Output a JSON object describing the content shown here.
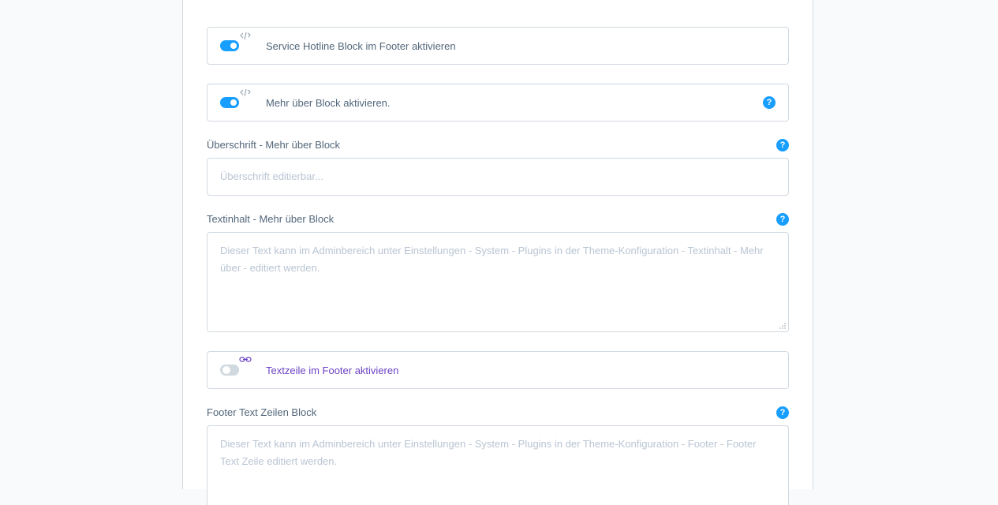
{
  "fields": {
    "hotline": {
      "label": "Service Hotline Block im Footer aktivieren",
      "enabled": true
    },
    "mehr_ueber": {
      "label": "Mehr über Block aktivieren.",
      "enabled": true
    },
    "ueberschrift": {
      "label": "Überschrift - Mehr über Block",
      "placeholder": "Überschrift editierbar..."
    },
    "textinhalt": {
      "label": "Textinhalt - Mehr über Block",
      "placeholder_line1": "Dieser Text kann im Adminbereich unter Einstellungen - System - Plugins in der Theme-Konfiguration - Textinhalt - Mehr",
      "placeholder_line2": "über - editiert werden."
    },
    "textzeile": {
      "label": "Textzeile im Footer aktivieren",
      "enabled": false
    },
    "footer_text": {
      "label": "Footer Text Zeilen Block",
      "placeholder_line1": "Dieser Text kann im Adminbereich unter Einstellungen - System - Plugins in der Theme-Konfiguration - Footer - Footer",
      "placeholder_line2": "Text Zeile editiert werden."
    }
  },
  "help_glyph": "?",
  "colors": {
    "accent": "#189eff",
    "linked": "#6c43c4",
    "border": "#d1d9e0",
    "placeholder": "#b9c5d3"
  }
}
